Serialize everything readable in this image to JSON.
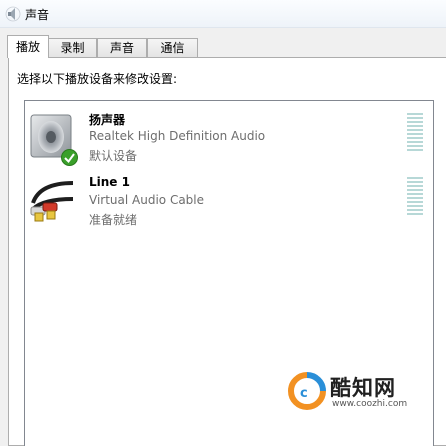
{
  "window": {
    "title": "声音"
  },
  "tabs": [
    {
      "label": "播放",
      "active": true
    },
    {
      "label": "录制",
      "active": false
    },
    {
      "label": "声音",
      "active": false
    },
    {
      "label": "通信",
      "active": false
    }
  ],
  "instruction": "选择以下播放设备来修改设置:",
  "devices": [
    {
      "name": "扬声器",
      "description": "Realtek High Definition Audio",
      "status": "默认设备",
      "icon": "speaker-icon",
      "default_badge": "green-check-icon"
    },
    {
      "name": "Line 1",
      "description": "Virtual Audio Cable",
      "status": "准备就绪",
      "icon": "rca-cable-icon"
    }
  ],
  "watermark": {
    "text": "酷知网",
    "url": "www.coozhi.com",
    "logo": "coozhi-logo-icon"
  },
  "colors": {
    "meter": "#b7d8d7",
    "check": "#3aa02a",
    "status_text": "#6d6d6d",
    "accent_logo_orange": "#f29122",
    "accent_logo_blue": "#2a8fd8"
  }
}
